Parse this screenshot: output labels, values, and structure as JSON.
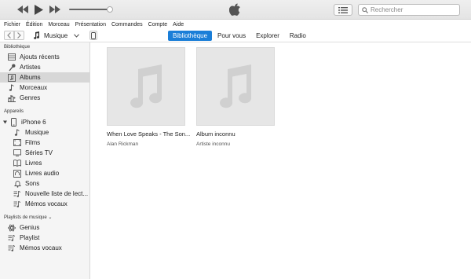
{
  "search": {
    "placeholder": "Rechercher"
  },
  "menu": [
    "Fichier",
    "Édition",
    "Morceau",
    "Présentation",
    "Commandes",
    "Compte",
    "Aide"
  ],
  "nav": {
    "media_type": "Musique",
    "tabs": [
      "Bibliothèque",
      "Pour vous",
      "Explorer",
      "Radio"
    ],
    "active_tab": "Bibliothèque"
  },
  "sidebar": {
    "library_header": "Bibliothèque",
    "library": [
      {
        "label": "Ajouts récents",
        "icon": "recent-grid-icon"
      },
      {
        "label": "Artistes",
        "icon": "microphone-icon"
      },
      {
        "label": "Albums",
        "icon": "album-icon"
      },
      {
        "label": "Morceaux",
        "icon": "note-icon"
      },
      {
        "label": "Genres",
        "icon": "genres-icon"
      }
    ],
    "devices_header": "Appareils",
    "device_name": "iPhone 6",
    "device_items": [
      {
        "label": "Musique",
        "icon": "note-icon"
      },
      {
        "label": "Films",
        "icon": "film-icon"
      },
      {
        "label": "Séries TV",
        "icon": "tv-icon"
      },
      {
        "label": "Livres",
        "icon": "book-icon"
      },
      {
        "label": "Livres audio",
        "icon": "audiobook-icon"
      },
      {
        "label": "Sons",
        "icon": "bell-icon"
      },
      {
        "label": "Nouvelle liste de lect...",
        "icon": "playlist-icon"
      },
      {
        "label": "Mémos vocaux",
        "icon": "playlist-icon"
      }
    ],
    "playlists_header": "Playlists de musique ⌄",
    "playlists": [
      {
        "label": "Genius",
        "icon": "genius-icon"
      },
      {
        "label": "Playlist",
        "icon": "playlist-icon"
      },
      {
        "label": "Mémos vocaux",
        "icon": "playlist-icon"
      }
    ],
    "selected": "Albums"
  },
  "albums": [
    {
      "title": "When Love Speaks - The Son...",
      "artist": "Alan Rickman"
    },
    {
      "title": "Album inconnu",
      "artist": "Artiste inconnu"
    }
  ],
  "colors": {
    "accent": "#1a7ed8",
    "selected_row": "#d7d7d7",
    "sidebar_bg": "#f5f5f5",
    "cover_bg": "#e6e6e6"
  }
}
